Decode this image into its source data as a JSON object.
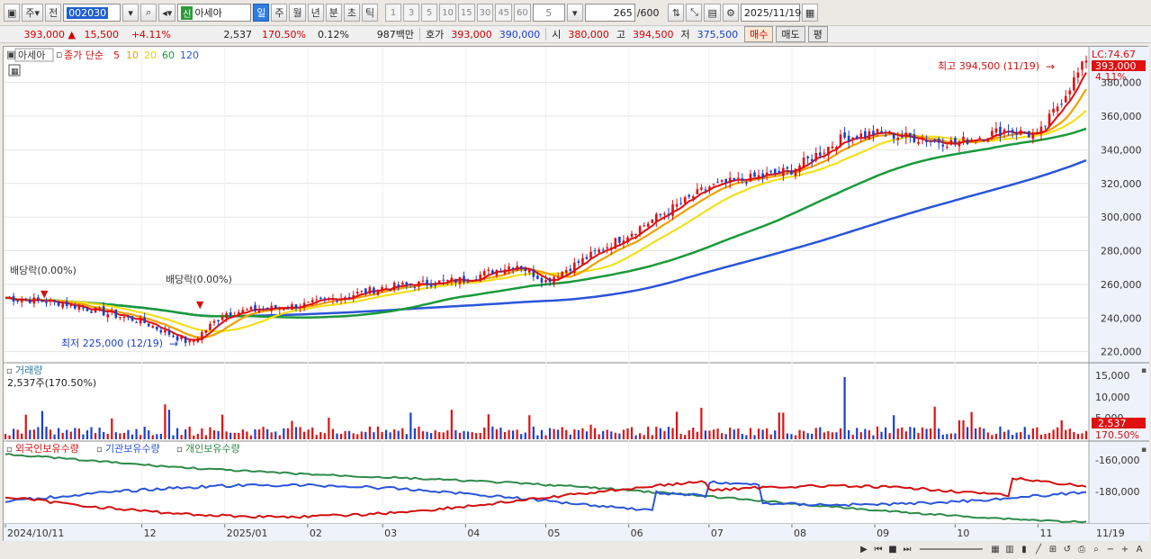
{
  "toolbar": {
    "market": "주",
    "prev_label": "전",
    "stock_code": "002030",
    "badge": "신",
    "stock_name": "아세아",
    "periods": [
      "일",
      "주",
      "월",
      "년",
      "분",
      "초",
      "틱"
    ],
    "active_period": "일",
    "intervals": [
      "1",
      "3",
      "5",
      "10",
      "15",
      "30",
      "45",
      "60"
    ],
    "interval_value": "5",
    "count": "265",
    "count_max": "/600",
    "date": "2025/11/19"
  },
  "quote": {
    "price": "393,000",
    "direction": "▲",
    "change": "15,500",
    "change_pct": "+4.11%",
    "volume": "2,537",
    "volume_ratio": "170.50%",
    "turnover_pct": "0.12%",
    "amount": "987백만",
    "hoga_label": "호가",
    "ask": "393,000",
    "bid": "390,000",
    "open_label": "시",
    "open": "380,000",
    "high_label": "고",
    "high": "394,500",
    "low_label": "저",
    "low": "375,500",
    "buy_label": "매수",
    "sell_label": "매도",
    "eval_label": "평"
  },
  "price_panel": {
    "name_tag": "아세아",
    "legend": "종가 단순",
    "ma_periods": [
      "5",
      "10",
      "20",
      "60",
      "120"
    ],
    "ma_colors": [
      "#e01010",
      "#f0a000",
      "#f2e01a",
      "#1a9a3a",
      "#2a55d8"
    ],
    "lc_label": "LC:74.67",
    "current_price": "393,000",
    "current_pct": "4.11%",
    "y_ticks": [
      "380,000",
      "360,000",
      "340,000",
      "320,000",
      "300,000",
      "280,000",
      "260,000",
      "240,000",
      "220,000"
    ],
    "annotations": {
      "high": "최고 394,500 (11/19)",
      "low": "최저 225,000 (12/19)",
      "dividend1": "배당락(0.00%)",
      "dividend2": "배당락(0.00%)"
    }
  },
  "volume_panel": {
    "title": "거래량",
    "value": "2,537주(170.50%)",
    "y_ticks": [
      "15,000",
      "10,000",
      "5,000"
    ],
    "current": "2,537",
    "current_pct": "170.50%"
  },
  "holding_panel": {
    "series": [
      "외국인보유수량",
      "기관보유수량",
      "개인보유수량"
    ],
    "colors": [
      "#d31010",
      "#2a55d8",
      "#2e8a4a"
    ],
    "y_ticks": [
      "-160,000",
      "-180,000"
    ]
  },
  "x_axis": {
    "labels": [
      "2024/10/11",
      "12",
      "2025/01",
      "02",
      "03",
      "04",
      "05",
      "06",
      "07",
      "08",
      "09",
      "10",
      "11"
    ],
    "last_date": "11/19"
  },
  "chart_data": {
    "type": "candlestick",
    "price_range": [
      215000,
      398000
    ],
    "close_anchors": [
      {
        "date": "2024/10/11",
        "close": 252000
      },
      {
        "date": "2024/11/01",
        "close": 249000
      },
      {
        "date": "2024/12/01",
        "close": 238000
      },
      {
        "date": "2024/12/19",
        "close": 225000
      },
      {
        "date": "2025/01/01",
        "close": 243000
      },
      {
        "date": "2025/02/01",
        "close": 248000
      },
      {
        "date": "2025/03/01",
        "close": 258000
      },
      {
        "date": "2025/04/01",
        "close": 263000
      },
      {
        "date": "2025/04/20",
        "close": 272000
      },
      {
        "date": "2025/05/01",
        "close": 262000
      },
      {
        "date": "2025/06/01",
        "close": 290000
      },
      {
        "date": "2025/07/01",
        "close": 318000
      },
      {
        "date": "2025/08/01",
        "close": 328000
      },
      {
        "date": "2025/08/20",
        "close": 347000
      },
      {
        "date": "2025/09/01",
        "close": 350000
      },
      {
        "date": "2025/10/01",
        "close": 344000
      },
      {
        "date": "2025/10/20",
        "close": 352000
      },
      {
        "date": "2025/11/01",
        "close": 348000
      },
      {
        "date": "2025/11/19",
        "close": 393000
      }
    ],
    "volume_spike": {
      "date": "2025/08/20",
      "volume": 15000
    }
  }
}
